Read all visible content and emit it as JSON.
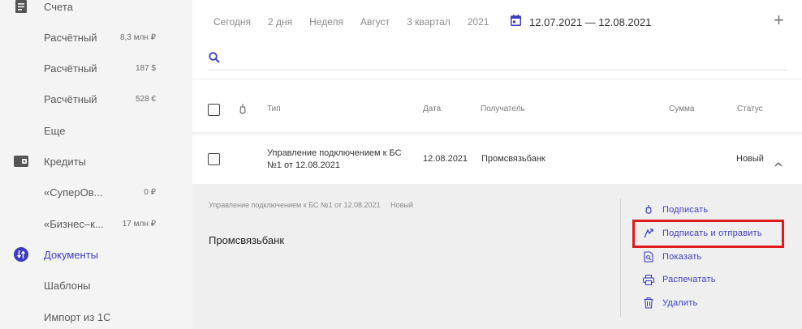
{
  "sidebar": {
    "accounts_label": "Счета",
    "accounts": [
      {
        "label": "Расчётный",
        "value": "8,3 млн ₽"
      },
      {
        "label": "Расчётный",
        "value": "187 $"
      },
      {
        "label": "Расчётный",
        "value": "528 €"
      }
    ],
    "more_label": "Еще",
    "credits_label": "Кредиты",
    "credits": [
      {
        "label": "«СуперОв...",
        "value": "0 ₽"
      },
      {
        "label": "«Бизнес–к...",
        "value": "17 млн ₽"
      }
    ],
    "documents_label": "Документы",
    "templates_label": "Шаблоны",
    "import_label": "Импорт из 1С"
  },
  "filters": {
    "periods": [
      "Сегодня",
      "2 дня",
      "Неделя",
      "Август",
      "3 квартал",
      "2021"
    ],
    "date_range": "12.07.2021 — 12.08.2021",
    "add_label": "+",
    "search_placeholder": ""
  },
  "table": {
    "headers": {
      "type": "Тип",
      "date": "Дата",
      "recipient": "Получатель",
      "amount": "Сумма",
      "status": "Статус"
    },
    "rows": [
      {
        "type_line1": "Управление подключением к БС",
        "type_line2": "№1 от 12.08.2021",
        "date": "12.08.2021",
        "recipient": "Промсвязьбанк",
        "amount": "",
        "status": "Новый"
      }
    ]
  },
  "detail": {
    "doc_title": "Управление подключением к БС №1 от 12.08.2021",
    "status": "Новый",
    "recipient": "Промсвязьбанк",
    "actions": {
      "sign": "Подписать",
      "sign_send": "Подписать и отправить",
      "show": "Показать",
      "print": "Распечатать",
      "delete": "Удалить"
    }
  },
  "colors": {
    "accent": "#3d3dc2",
    "highlight": "#e01a1a",
    "sidebar_bg": "#f4f4f4",
    "detail_bg": "#efefef"
  }
}
